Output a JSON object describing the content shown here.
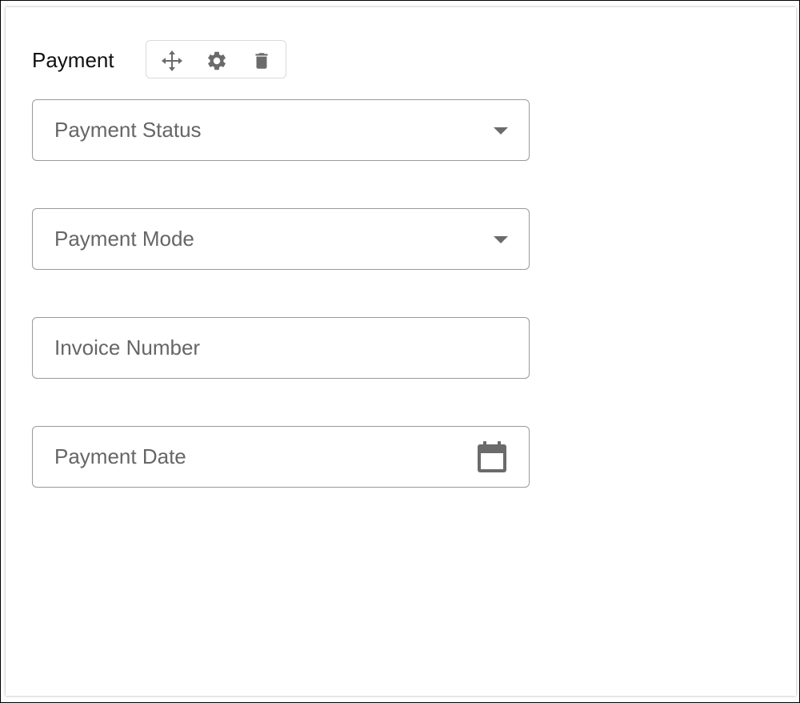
{
  "section": {
    "title": "Payment"
  },
  "toolbar": {
    "items": [
      {
        "icon": "move-icon"
      },
      {
        "icon": "gear-icon"
      },
      {
        "icon": "trash-icon"
      }
    ],
    "icon_color": "#6b6b6b"
  },
  "fields": {
    "payment_status": {
      "label": "Payment Status",
      "type": "select"
    },
    "payment_mode": {
      "label": "Payment Mode",
      "type": "select"
    },
    "invoice_number": {
      "label": "Invoice Number",
      "type": "text"
    },
    "payment_date": {
      "label": "Payment Date",
      "type": "date",
      "icon": "calendar-icon"
    }
  },
  "colors": {
    "border": "#9a9a9a",
    "label": "#666666",
    "title": "#111111"
  }
}
